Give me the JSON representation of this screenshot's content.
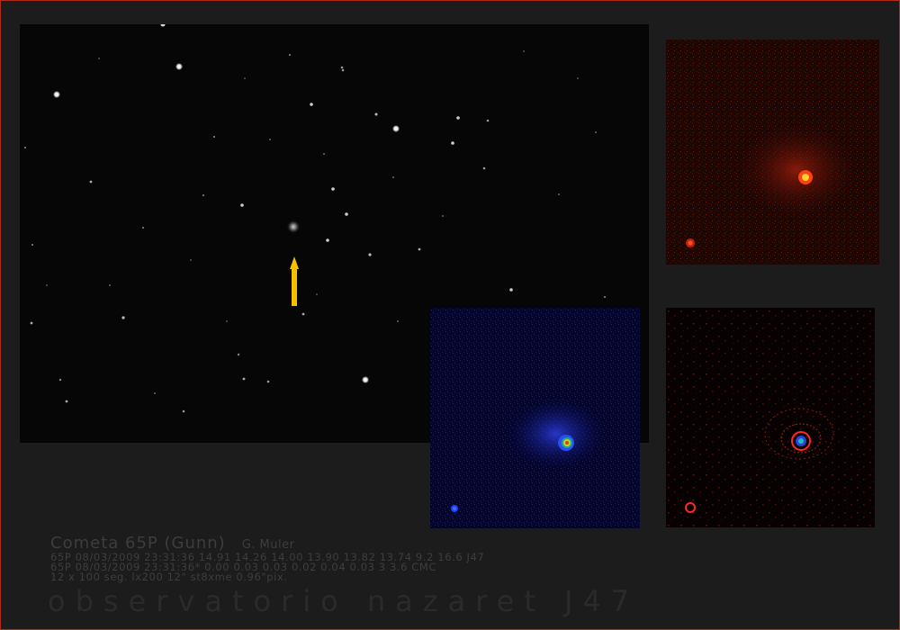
{
  "caption": {
    "title": "Cometa 65P (Gunn)",
    "author": "G. Muler",
    "line1": "65P 08/03/2009 23:31:36 14.91 14.26 14.00 13.90 13.82 13.74 9.2 16.6 J47",
    "line2": "65P 08/03/2009 23:31:36* 0.00 0.03 0.03 0.02 0.04 0.03 3 3.6 CMC",
    "line3": "12 x 100 seg. lx200 12\" st8xme 0.96\"pix."
  },
  "banner": "observatorio nazaret J47",
  "colors": {
    "border": "#b02a18",
    "arrow": "#f5c000",
    "caption_text": "#3d3d3d"
  },
  "icons": {
    "pointer": "up-arrow-icon"
  }
}
